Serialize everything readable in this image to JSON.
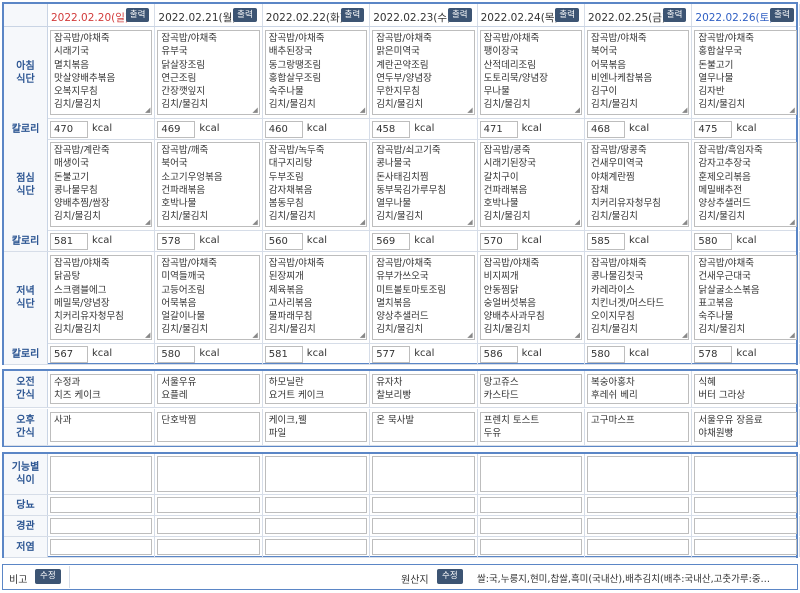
{
  "days": [
    {
      "date": "2022.02.20(일)",
      "type": "sun"
    },
    {
      "date": "2022.02.21(월)",
      "type": "wd"
    },
    {
      "date": "2022.02.22(화)",
      "type": "wd"
    },
    {
      "date": "2022.02.23(수)",
      "type": "wd"
    },
    {
      "date": "2022.02.24(목)",
      "type": "wd"
    },
    {
      "date": "2022.02.25(금)",
      "type": "wd"
    },
    {
      "date": "2022.02.26(토)",
      "type": "sat"
    }
  ],
  "print_label": "출력",
  "kcal_unit": "kcal",
  "colors": {
    "border": "#5b86c6",
    "label": "#2d5693",
    "button": "#3c5473",
    "sunday": "#d23b3b",
    "saturday": "#2f5fc4"
  },
  "meals": [
    {
      "label": "아침\n식단",
      "calorie_label": "칼로리",
      "menus": [
        "잡곡밥/야채죽\n시래기국\n멸치볶음\n맛살양배추볶음\n오복지무침\n김치/물김치",
        "잡곡밥/야채죽\n유부국\n닭살장조림\n연근조림\n간장깻잎지\n김치/물김치",
        "잡곡밥/야채죽\n배추된장국\n동그랑땡조림\n홍합살무조림\n숙주나물\n김치/물김치",
        "잡곡밥/야채죽\n맑은미역국\n계란곤약조림\n연두부/양념장\n무한지무침\n김치/물김치",
        "잡곡밥/야채죽\n팽이장국\n산적데리조림\n도토리묵/양념장\n무나물\n김치/물김치",
        "잡곡밥/야채죽\n북어국\n어묵볶음\n비엔나케찹볶음\n김구이\n김치/물김치",
        "잡곡밥/야채죽\n홍합살무국\n돈불고기\n열무나물\n김자반\n김치/물김치"
      ],
      "kcal": [
        "470",
        "469",
        "460",
        "458",
        "471",
        "468",
        "475"
      ]
    },
    {
      "label": "점심\n식단",
      "calorie_label": "칼로리",
      "menus": [
        "잡곡밥/계란죽\n매생이국\n돈불고기\n콩나물무침\n양배추찜/쌈장\n김치/물김치",
        "잡곡밥/깨죽\n북어국\n소고기우엉볶음\n건파래볶음\n호박나물\n김치/물김치",
        "잡곡밥/녹두죽\n대구지리탕\n두부조림\n감자채볶음\n봄동무침\n김치/물김치",
        "잡곡밥/쇠고기죽\n콩나물국\n돈사태김치찜\n동부묵김가루무침\n열무나물\n김치/물김치",
        "잡곡밥/콩죽\n시래기된장국\n갈치구이\n건파래볶음\n호박나물\n김치/물김치",
        "잡곡밥/땅콩죽\n건새우미역국\n야채계란찜\n잡채\n치커리유자청무침\n김치/물김치",
        "잡곡밥/흑임자죽\n감자고추장국\n훈제오리볶음\n메밀배추전\n양상추샐러드\n김치/물김치"
      ],
      "kcal": [
        "581",
        "578",
        "560",
        "569",
        "570",
        "585",
        "580"
      ]
    },
    {
      "label": "저녁\n식단",
      "calorie_label": "칼로리",
      "menus": [
        "잡곡밥/야채죽\n닭곰탕\n스크램블에그\n메밀묵/양념장\n치커리유자청무침\n김치/물김치",
        "잡곡밥/야채죽\n미역들깨국\n고등어조림\n어묵볶음\n얼갈이나물\n김치/물김치",
        "잡곡밥/야채죽\n된장찌개\n제육볶음\n고사리볶음\n물파래무침\n김치/물김치",
        "잡곡밥/야채죽\n유부가쓰오국\n미트볼토마토조림\n멸치볶음\n양상추샐러드\n김치/물김치",
        "잡곡밥/야채죽\n비지찌개\n안동찜닭\n숭얼버섯볶음\n양배추사과무침\n김치/물김치",
        "잡곡밥/야채죽\n콩나물김칫국\n카레라이스\n치킨너겟/머스타드\n오이지무침\n김치/물김치",
        "잡곡밥/야채죽\n건새우근대국\n닭살굴소스볶음\n표고볶음\n숙주나물\n김치/물김치"
      ],
      "kcal": [
        "567",
        "580",
        "581",
        "577",
        "586",
        "580",
        "578"
      ]
    }
  ],
  "snacks": [
    {
      "label": "오전\n간식",
      "items": [
        "수정과\n치즈 케이크",
        "서울우유\n요플레",
        "하모닐란\n요거트 케이크",
        "유자차\n찰보리빵",
        "망고쥬스\n카스타드",
        "복숭아홍차\n후레쉬 베리",
        "식혜\n버터 그라상"
      ]
    },
    {
      "label": "오후\n간식",
      "items": [
        "사과",
        "단호박찜",
        "케이크,웰\n파일",
        "온 묵사발",
        "프렌치 토스트\n두유",
        "고구마스프",
        "서울우유 장음료\n야채원빵"
      ]
    }
  ],
  "special_diets": [
    {
      "label": "기능별\n식이"
    },
    {
      "label": "당뇨"
    },
    {
      "label": "경관"
    },
    {
      "label": "저염"
    }
  ],
  "footer": {
    "note_label": "비고",
    "edit_label": "수정",
    "origin_label": "원산지",
    "origin_edit_label": "수정",
    "origin_text": "쌀:국,누룽지,현미,찹쌀,흑미(국내산),배추김치(배추:국내산,고춧가루:중…"
  }
}
